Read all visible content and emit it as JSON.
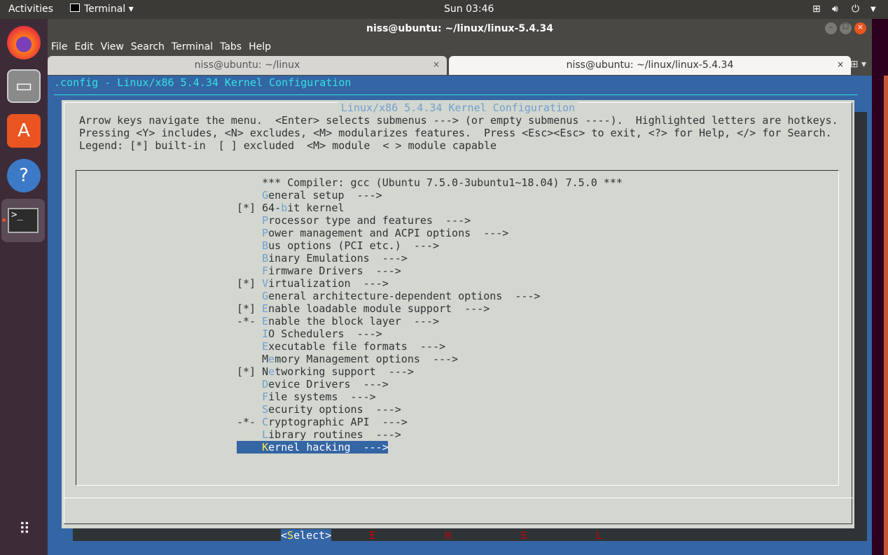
{
  "topbar": {
    "activities": "Activities",
    "app": "Terminal",
    "clock": "Sun 03:46"
  },
  "window": {
    "title": "niss@ubuntu: ~/linux/linux-5.4.34",
    "menu": [
      "File",
      "Edit",
      "View",
      "Search",
      "Terminal",
      "Tabs",
      "Help"
    ],
    "tabs": [
      {
        "label": "niss@ubuntu: ~/linux",
        "active": false
      },
      {
        "label": "niss@ubuntu: ~/linux/linux-5.4.34",
        "active": true
      }
    ]
  },
  "terminal": {
    "header": ".config - Linux/x86 5.4.34 Kernel Configuration",
    "dialog_title": "Linux/x86 5.4.34 Kernel Configuration",
    "help": [
      "Arrow keys navigate the menu.  <Enter> selects submenus ---> (or empty submenus ----).  Highlighted letters are hotkeys.",
      "Pressing <Y> includes, <N> excludes, <M> modularizes features.  Press <Esc><Esc> to exit, <?> for Help, </> for Search.",
      "Legend: [*] built-in  [ ] excluded  <M> module  < > module capable"
    ],
    "items": [
      {
        "prefix": "    ",
        "pre": "*** Compiler: gcc (Ubuntu 7.5.0-3ubuntu1~18.04) 7.5.0 ***",
        "hot": "",
        "rest": ""
      },
      {
        "prefix": "    ",
        "pre": "",
        "hot": "G",
        "rest": "eneral setup  --->"
      },
      {
        "prefix": "[*] ",
        "pre": "64-",
        "hot": "b",
        "rest": "it kernel"
      },
      {
        "prefix": "    ",
        "pre": "",
        "hot": "P",
        "rest": "rocessor type and features  --->"
      },
      {
        "prefix": "    ",
        "pre": "",
        "hot": "P",
        "rest": "ower management and ACPI options  --->"
      },
      {
        "prefix": "    ",
        "pre": "",
        "hot": "B",
        "rest": "us options (PCI etc.)  --->"
      },
      {
        "prefix": "    ",
        "pre": "",
        "hot": "B",
        "rest": "inary Emulations  --->"
      },
      {
        "prefix": "    ",
        "pre": "",
        "hot": "F",
        "rest": "irmware Drivers  --->"
      },
      {
        "prefix": "[*] ",
        "pre": "",
        "hot": "V",
        "rest": "irtualization  --->"
      },
      {
        "prefix": "    ",
        "pre": "",
        "hot": "G",
        "rest": "eneral architecture-dependent options  --->"
      },
      {
        "prefix": "[*] ",
        "pre": "",
        "hot": "E",
        "rest": "nable loadable module support  --->"
      },
      {
        "prefix": "-*- ",
        "pre": "",
        "hot": "E",
        "rest": "nable the block layer  --->"
      },
      {
        "prefix": "    ",
        "pre": "",
        "hot": "I",
        "rest": "O Schedulers  --->"
      },
      {
        "prefix": "    ",
        "pre": "",
        "hot": "E",
        "rest": "xecutable file formats  --->"
      },
      {
        "prefix": "    ",
        "pre": "M",
        "hot": "e",
        "rest": "mory Management options  --->"
      },
      {
        "prefix": "[*] ",
        "pre": "N",
        "hot": "e",
        "rest": "tworking support  --->"
      },
      {
        "prefix": "    ",
        "pre": "",
        "hot": "D",
        "rest": "evice Drivers  --->"
      },
      {
        "prefix": "    ",
        "pre": "",
        "hot": "F",
        "rest": "ile systems  --->"
      },
      {
        "prefix": "    ",
        "pre": "",
        "hot": "S",
        "rest": "ecurity options  --->"
      },
      {
        "prefix": "-*- ",
        "pre": "",
        "hot": "C",
        "rest": "ryptographic API  --->"
      },
      {
        "prefix": "    ",
        "pre": "",
        "hot": "L",
        "rest": "ibrary routines  --->"
      },
      {
        "prefix": "    ",
        "pre": "",
        "hot": "K",
        "rest": "ernel hacking  --->",
        "selected": true
      }
    ],
    "buttons": [
      {
        "l": "<",
        "k": "S",
        "r": "elect>",
        "active": true
      },
      {
        "l": "< ",
        "k": "E",
        "r": "xit >"
      },
      {
        "l": "< ",
        "k": "H",
        "r": "elp >"
      },
      {
        "l": "< ",
        "k": "S",
        "r": "ave >"
      },
      {
        "l": "< ",
        "k": "L",
        "r": "oad >"
      }
    ]
  },
  "colors": {
    "terminal_bg": "#3465a4",
    "dialog_bg": "#d3d7cf",
    "hotkey": "#729fcf",
    "selected_hotkey": "#fce94f",
    "button_hotkey": "#cc0000"
  }
}
